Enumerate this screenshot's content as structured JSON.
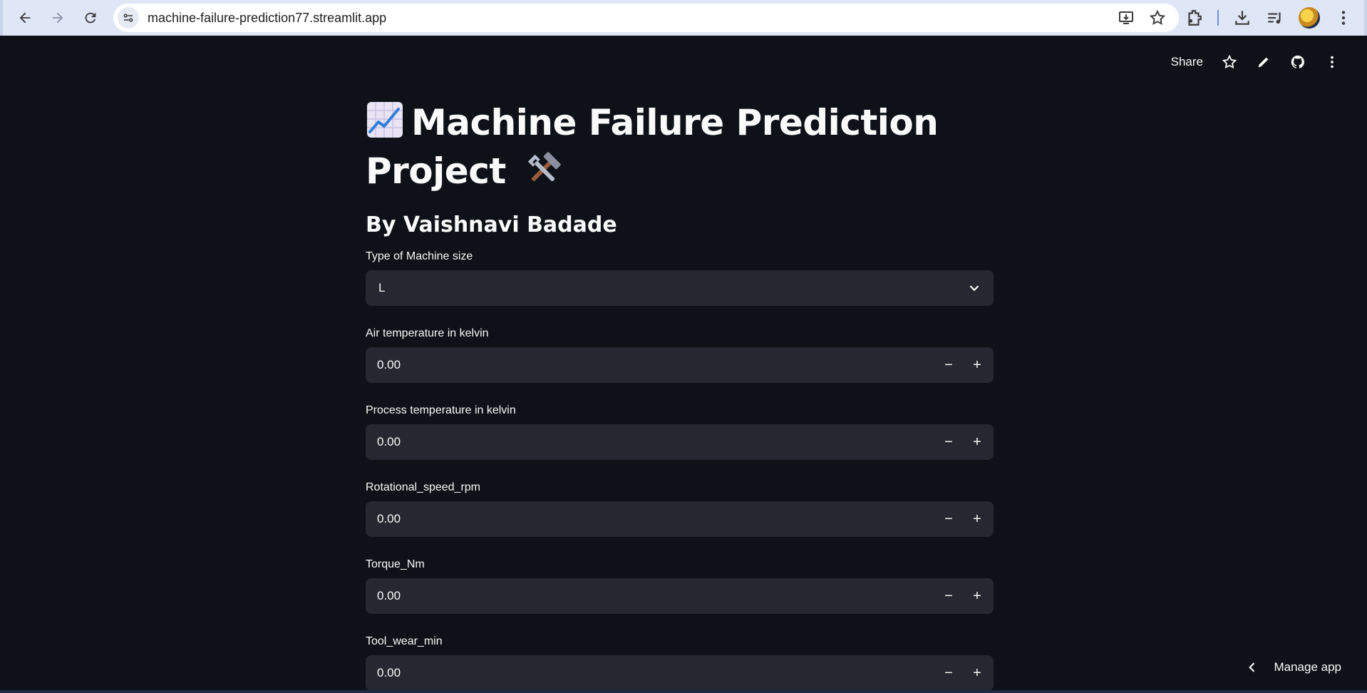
{
  "browser": {
    "url": "machine-failure-prediction77.streamlit.app"
  },
  "toolbar": {
    "share_label": "Share"
  },
  "app": {
    "title_line1": "Machine Failure Prediction",
    "title_line2": "Project",
    "subtitle": "By Vaishnavi Badade",
    "machine_type": {
      "label": "Type of Machine size",
      "value": "L"
    },
    "fields": [
      {
        "label": "Air temperature in kelvin",
        "value": "0.00"
      },
      {
        "label": "Process temperature in kelvin",
        "value": "0.00"
      },
      {
        "label": "Rotational_speed_rpm",
        "value": "0.00"
      },
      {
        "label": "Torque_Nm",
        "value": "0.00"
      },
      {
        "label": "Tool_wear_min",
        "value": "0.00"
      }
    ],
    "stepper": {
      "minus": "−",
      "plus": "+"
    },
    "manage_app_label": "Manage app"
  },
  "icons": {
    "title_leading": "chart-increasing-emoji",
    "title_trailing": "hammer-and-wrench-emoji"
  }
}
